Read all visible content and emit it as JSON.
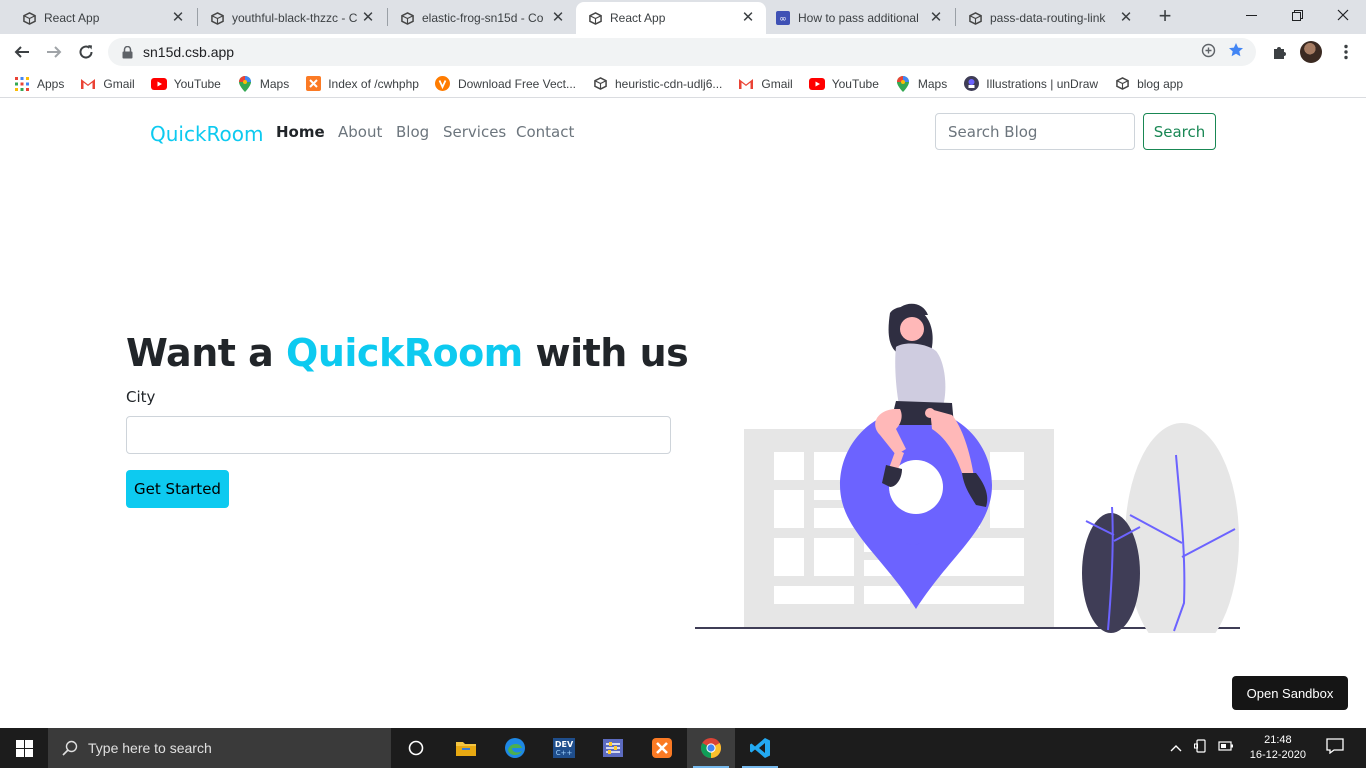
{
  "browser": {
    "tabs": [
      {
        "title": "React App",
        "active": false
      },
      {
        "title": "youthful-black-thzzc - C",
        "active": false
      },
      {
        "title": "elastic-frog-sn15d - Co",
        "active": false
      },
      {
        "title": "React App",
        "active": true
      },
      {
        "title": "How to pass additional",
        "active": false
      },
      {
        "title": "pass-data-routing-link",
        "active": false
      }
    ],
    "new_tab_label": "+",
    "url": "sn15d.csb.app",
    "bookmarks": [
      {
        "label": "Apps",
        "icon": "apps-grid-icon"
      },
      {
        "label": "Gmail",
        "icon": "gmail-icon"
      },
      {
        "label": "YouTube",
        "icon": "youtube-icon"
      },
      {
        "label": "Maps",
        "icon": "maps-icon"
      },
      {
        "label": "Index of /cwhphp",
        "icon": "xampp-icon"
      },
      {
        "label": "Download Free Vect...",
        "icon": "vecteezy-icon"
      },
      {
        "label": "heuristic-cdn-udlj6...",
        "icon": "codesandbox-icon"
      },
      {
        "label": "Gmail",
        "icon": "gmail-icon"
      },
      {
        "label": "YouTube",
        "icon": "youtube-icon"
      },
      {
        "label": "Maps",
        "icon": "maps-icon"
      },
      {
        "label": "Illustrations | unDraw",
        "icon": "undraw-icon"
      },
      {
        "label": "blog app",
        "icon": "codesandbox-icon"
      }
    ]
  },
  "navbar": {
    "brand": "QuickRoom",
    "links": [
      "Home",
      "About",
      "Blog",
      "Services",
      "Contact"
    ],
    "search_placeholder": "Search Blog",
    "search_button": "Search"
  },
  "hero": {
    "heading_prefix": "Want a ",
    "heading_accent": "QuickRoom",
    "heading_suffix": " with us",
    "city_label": "City",
    "city_value": "",
    "cta_button": "Get Started"
  },
  "sandbox_button": "Open Sandbox",
  "taskbar": {
    "search_placeholder": "Type here to search",
    "time": "21:48",
    "date": "16-12-2020"
  },
  "colors": {
    "brand": "#0dcaf0",
    "search_outline": "#198754",
    "illustration_accent": "#6c63ff"
  }
}
